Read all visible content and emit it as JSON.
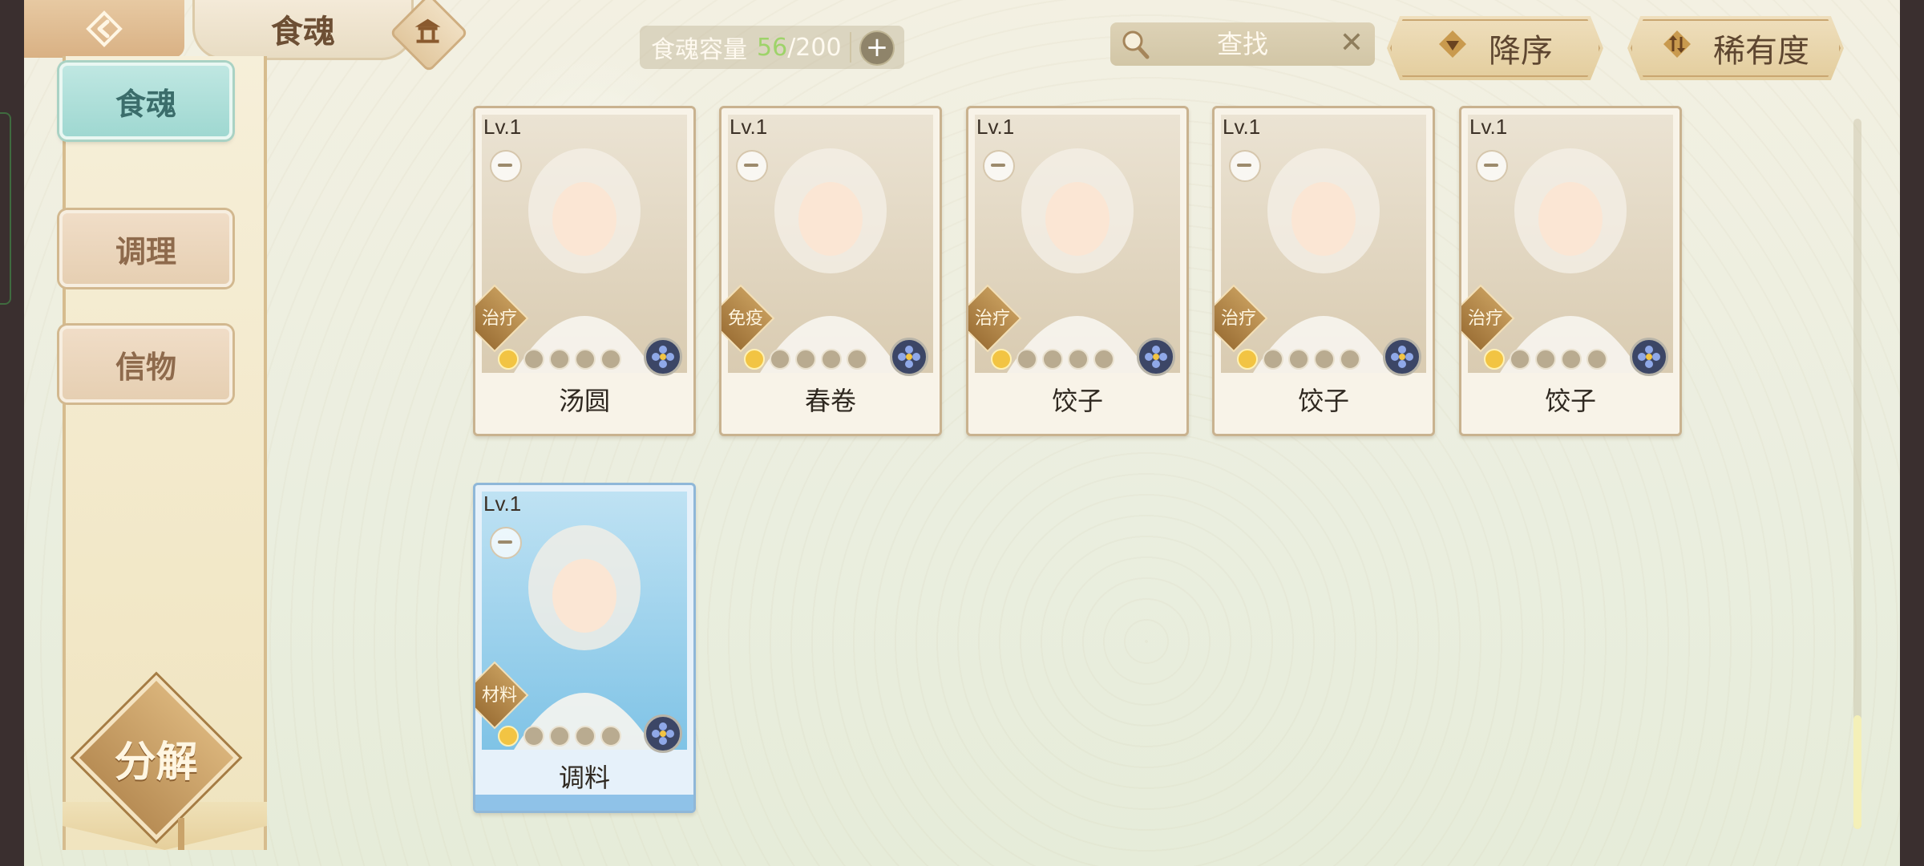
{
  "header": {
    "title": "食魂",
    "capacity": {
      "label": "食魂容量",
      "current": "56",
      "separator": "/",
      "max": "200"
    },
    "search_placeholder": "查找",
    "sort_order_label": "降序",
    "sort_by_label": "稀有度"
  },
  "sidebar": {
    "items": [
      {
        "label": "食魂",
        "active": true
      },
      {
        "label": "调理",
        "active": false
      },
      {
        "label": "信物",
        "active": false
      }
    ],
    "decompose_label": "分解"
  },
  "cards": [
    {
      "level": "Lv.1",
      "role": "治疗",
      "name": "汤圆",
      "stars_on": 1,
      "stars_total": 5,
      "frame": "standard"
    },
    {
      "level": "Lv.1",
      "role": "免疫",
      "name": "春卷",
      "stars_on": 1,
      "stars_total": 5,
      "frame": "standard"
    },
    {
      "level": "Lv.1",
      "role": "治疗",
      "name": "饺子",
      "stars_on": 1,
      "stars_total": 5,
      "frame": "standard"
    },
    {
      "level": "Lv.1",
      "role": "治疗",
      "name": "饺子",
      "stars_on": 1,
      "stars_total": 5,
      "frame": "standard"
    },
    {
      "level": "Lv.1",
      "role": "治疗",
      "name": "饺子",
      "stars_on": 1,
      "stars_total": 5,
      "frame": "standard"
    },
    {
      "level": "Lv.1",
      "role": "材料",
      "name": "调料",
      "stars_on": 1,
      "stars_total": 5,
      "frame": "blue"
    }
  ],
  "icons": {
    "back": "back-arrow-icon",
    "home": "pavilion-icon",
    "search": "magnifier-icon",
    "clear": "close-icon",
    "sort_order": "triangle-down-icon",
    "sort_by": "swap-icon",
    "bowl": "bowl-icon",
    "emblem": "flower-emblem-icon"
  },
  "colors": {
    "active_tab": "#9fd8d1",
    "capacity_current": "#9ed36a",
    "accent_brown": "#6d4f34"
  }
}
